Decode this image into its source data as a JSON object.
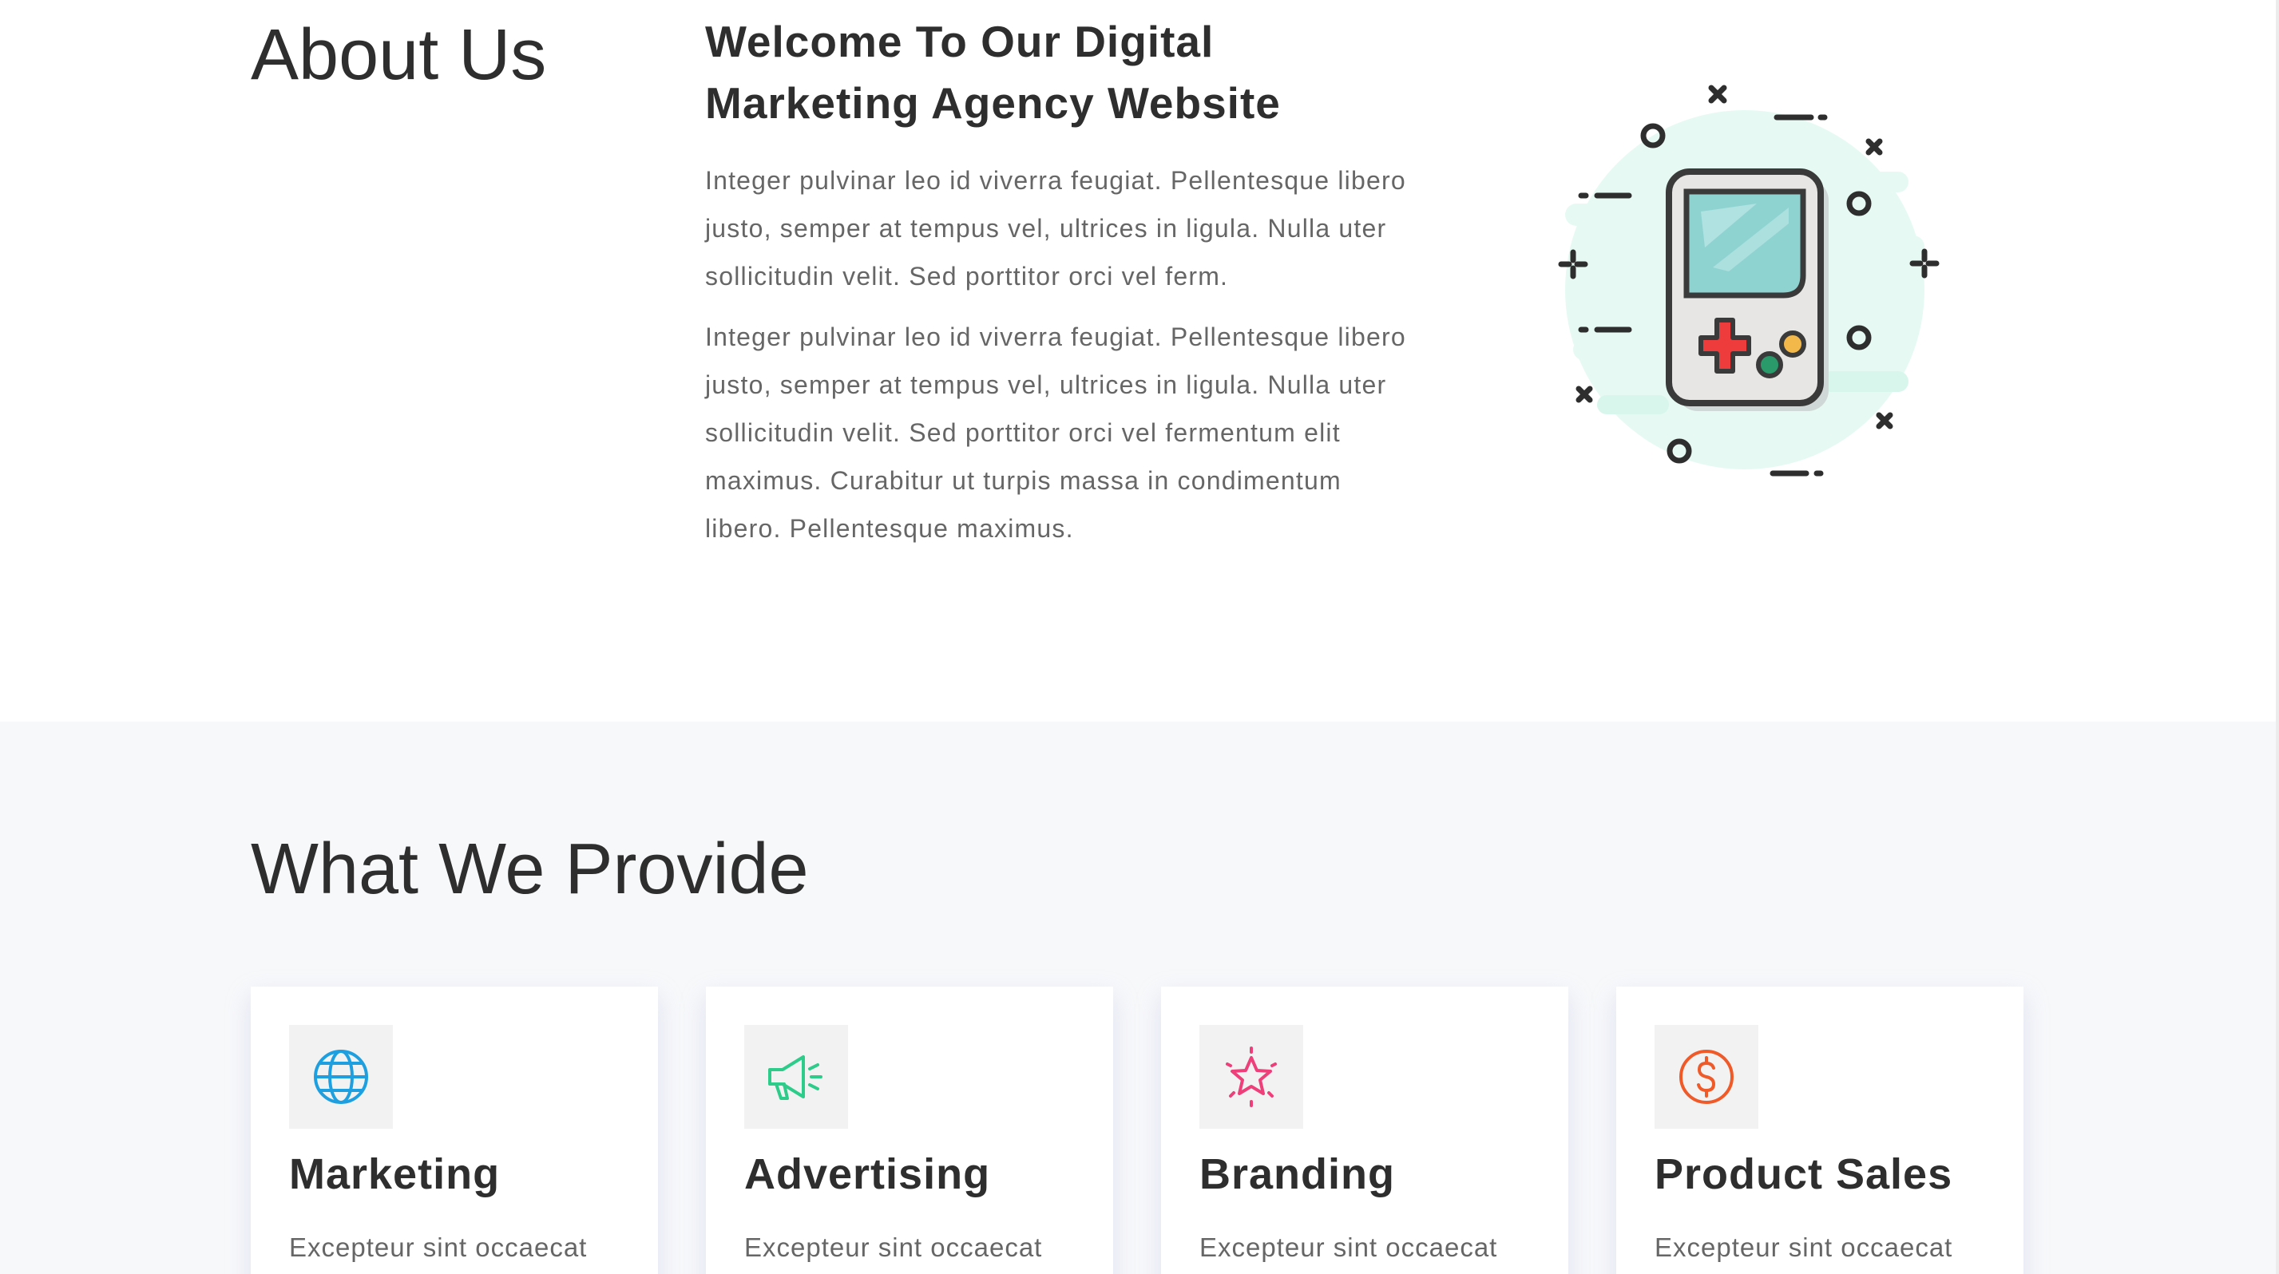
{
  "about": {
    "title": "About Us",
    "heading": "Welcome To Our Digital Marketing Agency Website",
    "paragraphs": [
      "Integer pulvinar leo id viverra feugiat. Pellentesque libero justo, semper at tempus vel, ultrices in ligula. Nulla uter sollicitudin velit. Sed porttitor orci vel ferm.",
      "Integer pulvinar leo id viverra feugiat. Pellentesque libero justo, semper at tempus vel, ultrices in ligula. Nulla uter sollicitudin velit. Sed porttitor orci vel fermentum elit maximus. Curabitur ut turpis massa in condimentum libero. Pellentesque maximus."
    ],
    "illustration_icon": "game-console-icon"
  },
  "services": {
    "title": "What We Provide",
    "cards": [
      {
        "icon": "globe-icon",
        "icon_color": "#1ea0e0",
        "title": "Marketing",
        "text": "Excepteur sint occaecat"
      },
      {
        "icon": "megaphone-icon",
        "icon_color": "#2ecc8a",
        "title": "Advertising",
        "text": "Excepteur sint occaecat"
      },
      {
        "icon": "star-icon",
        "icon_color": "#ee3f7a",
        "title": "Branding",
        "text": "Excepteur sint occaecat"
      },
      {
        "icon": "dollar-coin-icon",
        "icon_color": "#f05a28",
        "title": "Product Sales",
        "text": "Excepteur sint occaecat"
      }
    ]
  },
  "colors": {
    "text_dark": "#2e2e2e",
    "text_muted": "#666666",
    "section_bg": "#f7f8fa",
    "illustration_mint": "#e6faf3"
  }
}
